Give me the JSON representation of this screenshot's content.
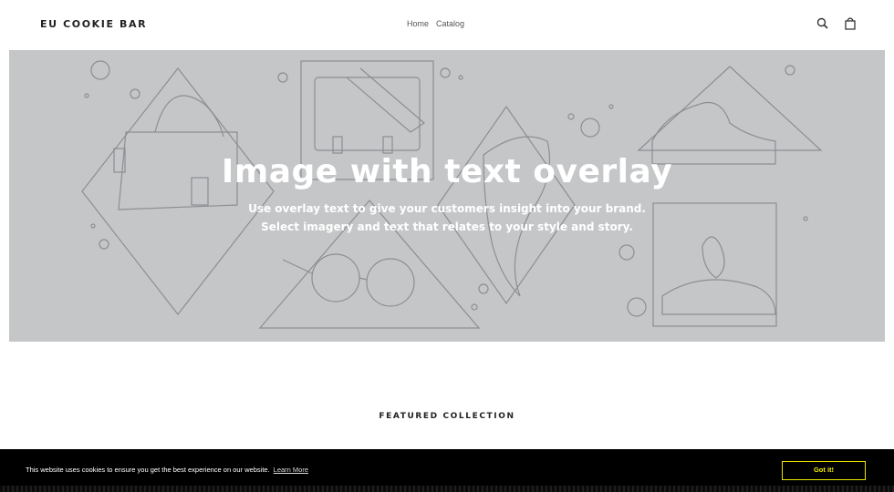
{
  "header": {
    "brand": "EU COOKIE BAR",
    "nav": [
      "Home",
      "Catalog"
    ],
    "icons": [
      "search-icon",
      "cart-icon"
    ]
  },
  "hero": {
    "title": "Image with text overlay",
    "subtitle_line1": "Use overlay text to give your customers insight into your brand.",
    "subtitle_line2": "Select imagery and text that relates to your style and story.",
    "background_color": "#c5c6c8"
  },
  "featured": {
    "heading": "FEATURED COLLECTION"
  },
  "cookie_bar": {
    "message": "This website uses cookies to ensure you get the best experience on our website.",
    "learn_more": "Learn More",
    "button": "Got it!",
    "accent_color": "#f3ef00"
  }
}
